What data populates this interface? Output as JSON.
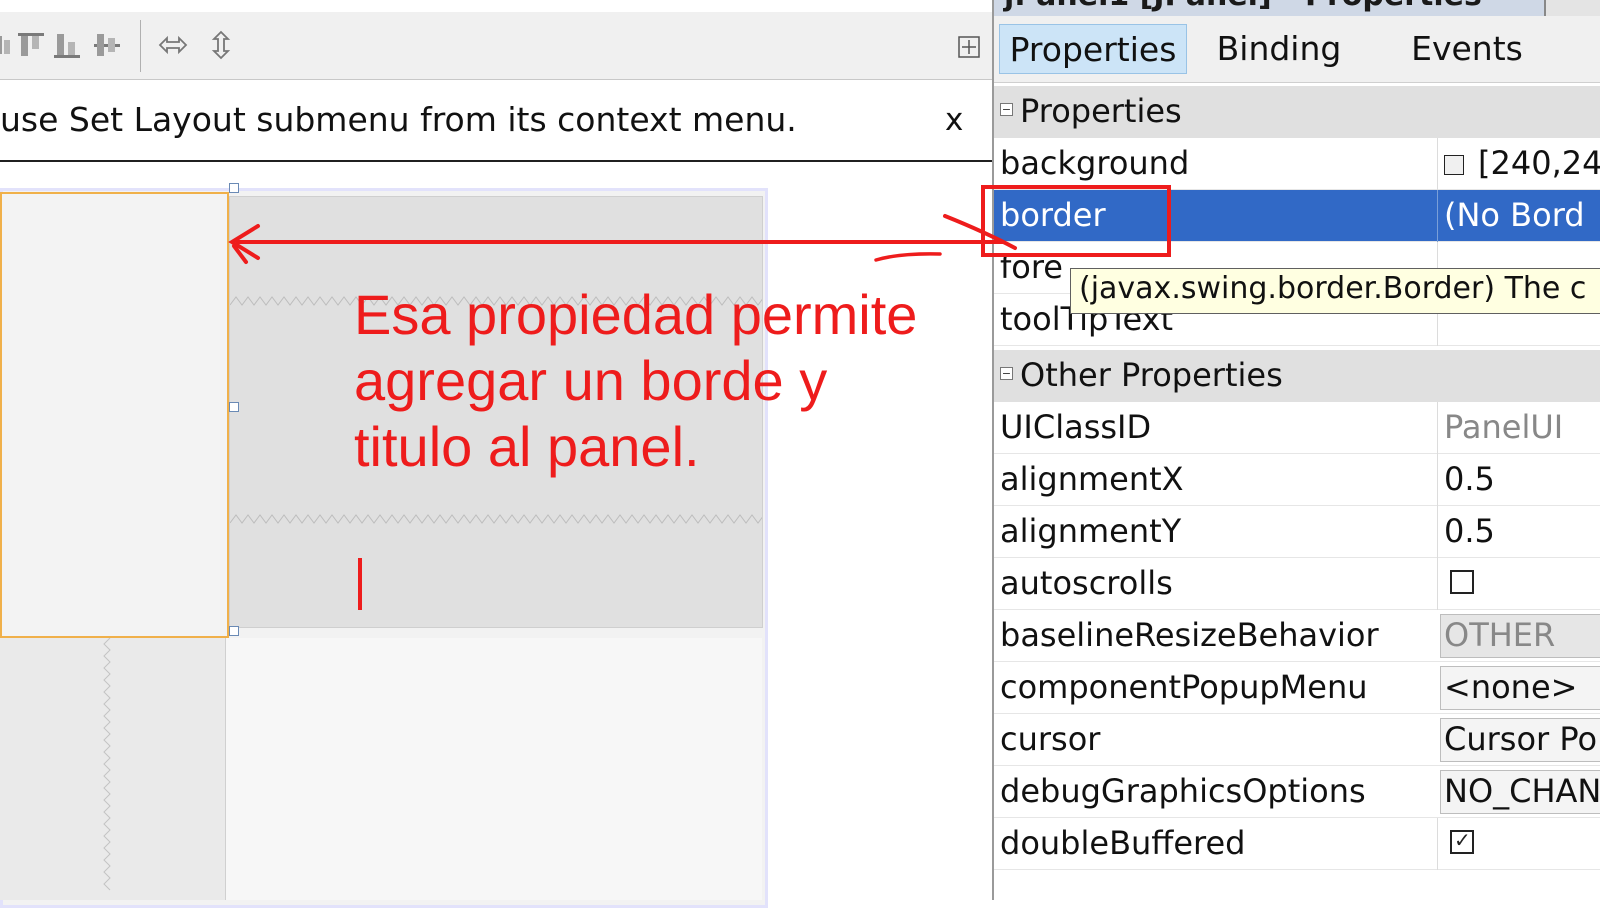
{
  "designer": {
    "toolbar_icons": [
      "align-left-icon",
      "align-top-icon",
      "align-bottom-icon",
      "align-center-icon",
      "resize-horizontal-icon",
      "resize-vertical-icon"
    ],
    "corner_icon": "expand-icon",
    "notice": "use Set Layout submenu from its context menu.",
    "notice_close": "x"
  },
  "properties_window": {
    "title": "j. anel1 [JPanel] - Properties",
    "tabs": [
      "Properties",
      "Binding",
      "Events"
    ],
    "active_tab": "Properties",
    "categories": {
      "properties": "Properties",
      "other_properties": "Other Properties"
    },
    "rows": {
      "background": {
        "name": "background",
        "value": "[240,24"
      },
      "border": {
        "name": "border",
        "value": "(No Bord"
      },
      "foreground": {
        "name": "fore"
      },
      "tooltiptext": {
        "name": "toolTipText",
        "value": ""
      },
      "uiclassid": {
        "name": "UIClassID",
        "value": "PanelUI"
      },
      "alignmentx": {
        "name": "alignmentX",
        "value": "0.5"
      },
      "alignmenty": {
        "name": "alignmentY",
        "value": "0.5"
      },
      "autoscrolls": {
        "name": "autoscrolls",
        "checked": false
      },
      "baseline": {
        "name": "baselineResizeBehavior",
        "value": "OTHER"
      },
      "popupmenu": {
        "name": "componentPopupMenu",
        "value": "<none>"
      },
      "cursor": {
        "name": "cursor",
        "value": "Cursor Po"
      },
      "debug": {
        "name": "debugGraphicsOptions",
        "value": "NO_CHAN"
      },
      "doublebuffered": {
        "name": "doubleBuffered",
        "checked": true
      }
    },
    "tooltip": "(javax.swing.border.Border)  The c"
  },
  "annotation": {
    "lines": [
      "Esa propiedad permite",
      "agregar un borde y",
      "titulo al panel."
    ],
    "color": "#ee1c1c"
  },
  "colors": {
    "selection": "#3169c6",
    "tooltip_bg": "#ffffe1",
    "annotation_red": "#ee1c1c",
    "panel_selection_border": "#f0b04a"
  }
}
